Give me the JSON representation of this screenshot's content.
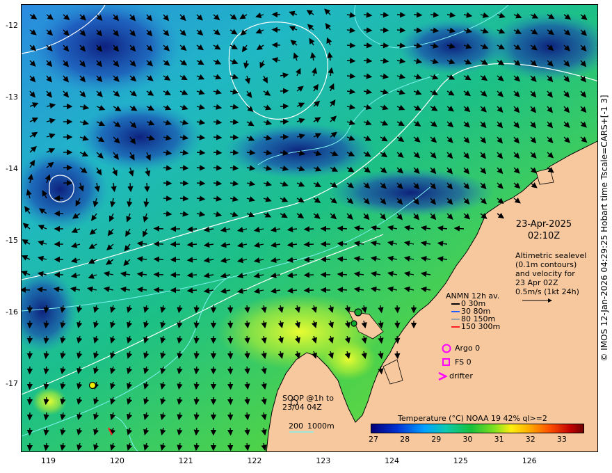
{
  "map": {
    "lon_min": 118.6,
    "lon_max": 127.0,
    "lat_min": -17.95,
    "lat_max": -11.7,
    "lat_ticks": [
      "-12",
      "-13",
      "-14",
      "-15",
      "-16",
      "-17"
    ],
    "lat_tick_values": [
      -12,
      -13,
      -14,
      -15,
      -16,
      -17
    ],
    "lon_ticks": [
      "119",
      "120",
      "121",
      "122",
      "123",
      "124",
      "125",
      "126"
    ],
    "lon_tick_values": [
      119,
      120,
      121,
      122,
      123,
      124,
      125,
      126
    ],
    "colors": {
      "land": "#f7c89e",
      "sst_low": "#0d1f8c",
      "sst_mid": "#18c03a",
      "sst_high": "#ffee10",
      "contour_white": "#ffffff",
      "contour_cyan": "#7ff0f0",
      "arrow": "#000000"
    }
  },
  "date": {
    "date": "23-Apr-2025",
    "time": "02:10Z"
  },
  "altimetry_note": {
    "line1": "Altimetric sealevel",
    "line2": "(0.1m contours)",
    "line3": "and velocity for",
    "line4": "23 Apr 02Z",
    "line5": "0.5m/s (1kt 24h)"
  },
  "anmn_legend": {
    "title": "ANMN 12h av.",
    "items": [
      {
        "label": "0 30m",
        "color": "#000000"
      },
      {
        "label": "30 80m",
        "color": "#2060ff"
      },
      {
        "label": "80 150m",
        "color": "#a0a0a0"
      },
      {
        "label": "150 300m",
        "color": "#ff2020"
      }
    ]
  },
  "platform_legend": {
    "argo": "Argo 0",
    "fs": "FS 0",
    "drifter": "drifter",
    "color": "#ff00ff"
  },
  "soop": {
    "line1": "SOOP @1h to",
    "line2": "23/04 04Z",
    "depth_200": "200",
    "depth_1000": "1000m"
  },
  "colorbar": {
    "title": "Temperature (°C) NOAA 19 42% ql>=2",
    "ticks": [
      "27",
      "28",
      "29",
      "30",
      "31",
      "32",
      "33"
    ],
    "tick_values": [
      27,
      28,
      29,
      30,
      31,
      32,
      33
    ],
    "range": [
      27,
      33.8
    ]
  },
  "credit": "© IMOS 12-Jan-2026 04:29:25 Hobart time Tscale=CARS+[-1 3]"
}
